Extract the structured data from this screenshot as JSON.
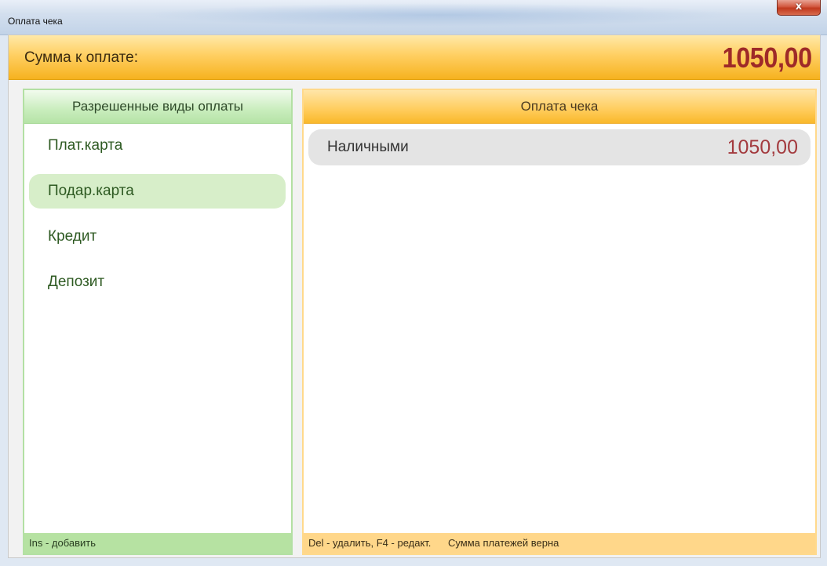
{
  "window": {
    "title": "Оплата чека",
    "close_glyph": "x"
  },
  "summary": {
    "label": "Сумма к оплате:",
    "amount": "1050,00"
  },
  "allowed_payments": {
    "header": "Разрешенные виды оплаты",
    "items": [
      {
        "label": "Плат.карта",
        "selected": false
      },
      {
        "label": "Подар.карта",
        "selected": true
      },
      {
        "label": "Кредит",
        "selected": false
      },
      {
        "label": "Депозит",
        "selected": false
      }
    ],
    "footer_hint": "Ins - добавить"
  },
  "check_payment": {
    "header": "Оплата чека",
    "payments": [
      {
        "method": "Наличными",
        "amount": "1050,00"
      }
    ],
    "footer_hint": "Del - удалить, F4 - редакт.",
    "footer_status": "Сумма платежей верна"
  },
  "colors": {
    "accent_orange": "#f6b21f",
    "accent_green": "#b5e3a6",
    "amount_red": "#9e2a28"
  },
  "icons": {
    "close": "close-icon"
  }
}
